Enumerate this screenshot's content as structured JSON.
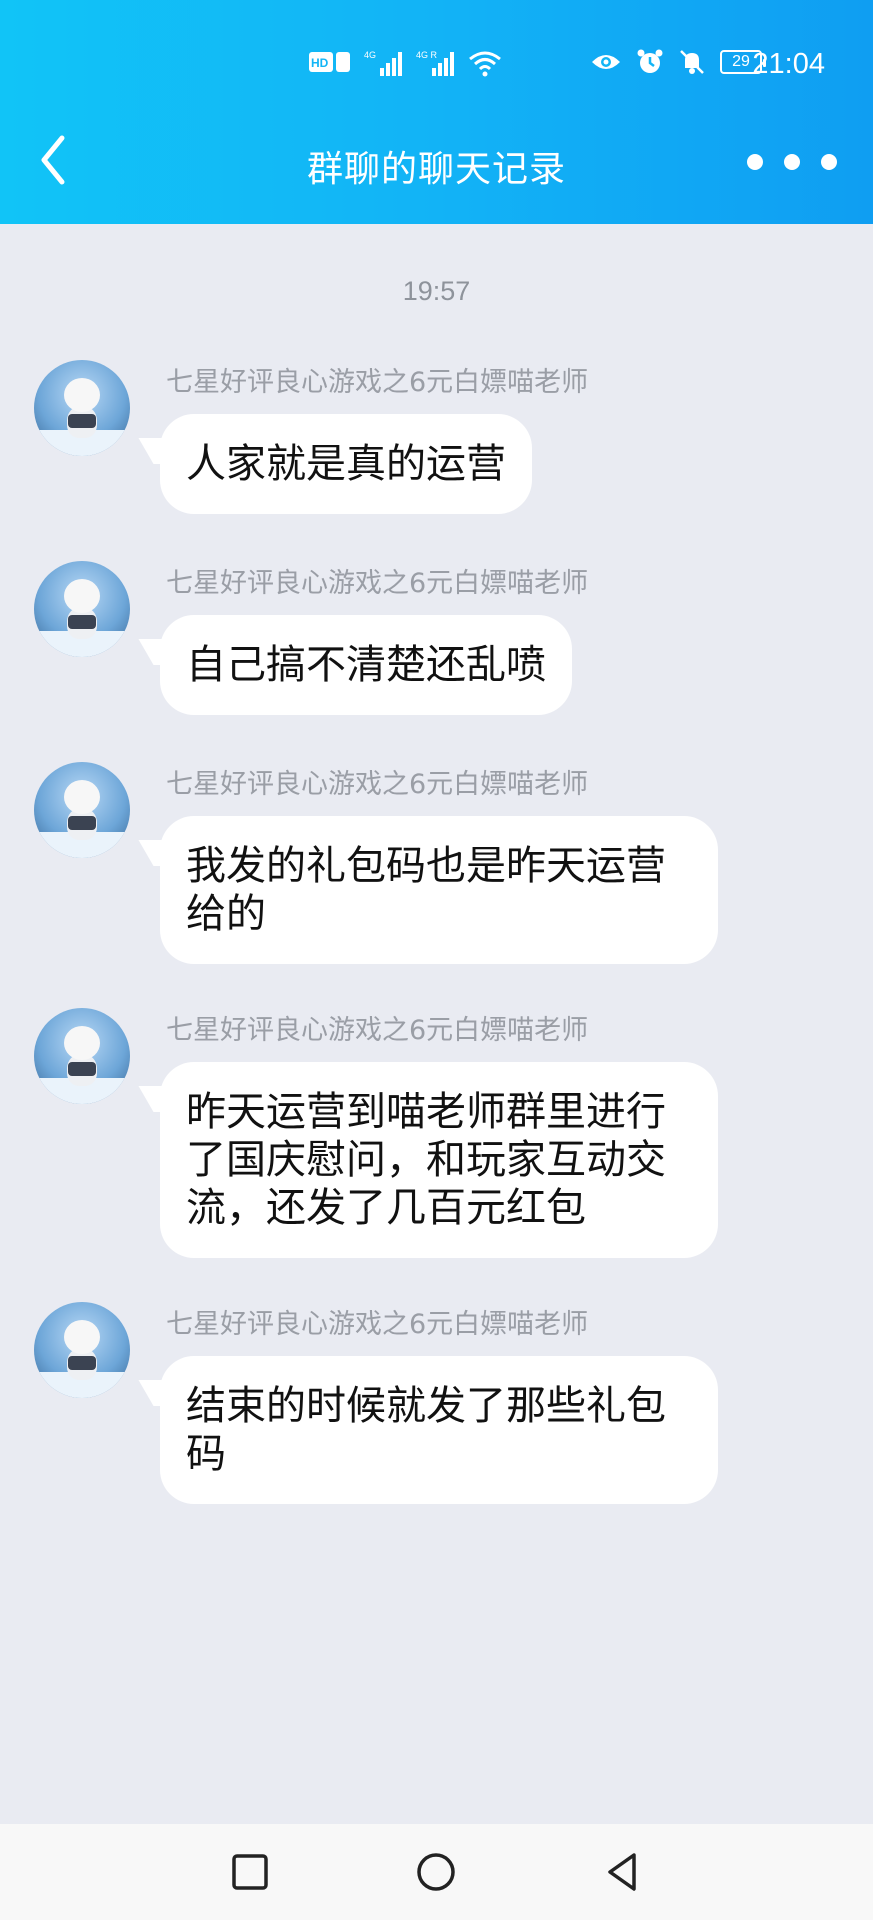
{
  "status_bar": {
    "network_badge": "HD",
    "sim1": "4G",
    "sim2": "4G R",
    "battery": "29",
    "time": "21:04"
  },
  "nav": {
    "title": "群聊的聊天记录"
  },
  "chat": {
    "timestamp": "19:57",
    "messages": [
      {
        "sender": "七星好评良心游戏之6元白嫖喵老师",
        "text": "人家就是真的运营"
      },
      {
        "sender": "七星好评良心游戏之6元白嫖喵老师",
        "text": "自己搞不清楚还乱喷"
      },
      {
        "sender": "七星好评良心游戏之6元白嫖喵老师",
        "lines": [
          "我发的礼包码也是昨天运营",
          "给的"
        ]
      },
      {
        "sender": "七星好评良心游戏之6元白嫖喵老师",
        "lines": [
          "昨天运营到喵老师群里进行",
          "了国庆慰问，和玩家互动交",
          "流，还发了几百元红包"
        ]
      },
      {
        "sender": "七星好评良心游戏之6元白嫖喵老师",
        "lines": [
          "结束的时候就发了那些礼包",
          "码"
        ]
      }
    ]
  },
  "icons": {
    "back": "back-arrow-icon",
    "more": "more-dots-icon",
    "system_nav": [
      "recent-apps-icon",
      "home-icon",
      "back-triangle-icon"
    ]
  },
  "colors": {
    "header_accent": "#12b3f6",
    "chat_bg": "#e9ebf2",
    "bubble": "#ffffff"
  }
}
